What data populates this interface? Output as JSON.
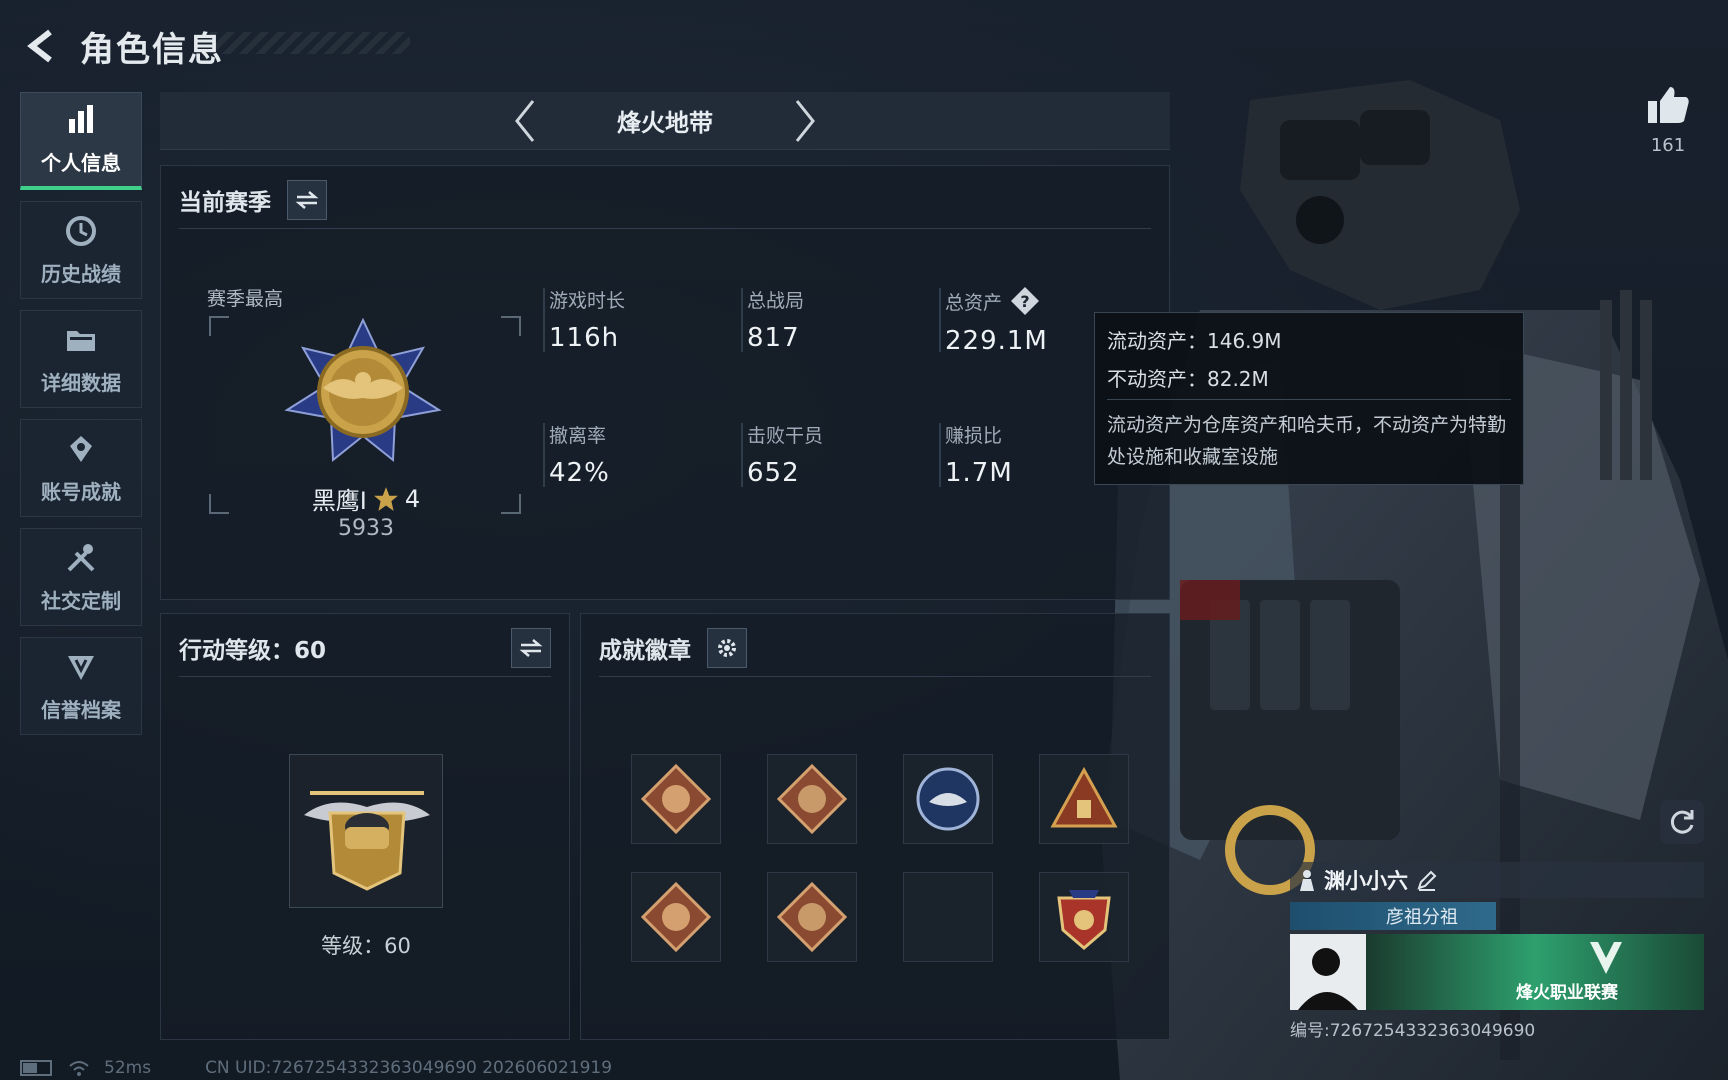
{
  "header": {
    "title": "角色信息"
  },
  "sidebar": {
    "items": [
      {
        "label": "个人信息",
        "icon": "bar-chart-icon",
        "active": true
      },
      {
        "label": "历史战绩",
        "icon": "clock-icon",
        "active": false
      },
      {
        "label": "详细数据",
        "icon": "folder-icon",
        "active": false
      },
      {
        "label": "账号成就",
        "icon": "achievement-icon",
        "active": false
      },
      {
        "label": "社交定制",
        "icon": "tools-icon",
        "active": false
      },
      {
        "label": "信誉档案",
        "icon": "shield-icon",
        "active": false
      }
    ]
  },
  "mode": {
    "title": "烽火地带"
  },
  "season": {
    "heading": "当前赛季",
    "best_label": "赛季最高",
    "rank_name": "黑鹰I",
    "rank_stars": "4",
    "rank_score": "5933",
    "stats": [
      {
        "key": "游戏时长",
        "value": "116h"
      },
      {
        "key": "总战局",
        "value": "817"
      },
      {
        "key": "总资产",
        "value": "229.1M"
      },
      {
        "key": "撤离率",
        "value": "42%"
      },
      {
        "key": "击败干员",
        "value": "652"
      },
      {
        "key": "赚损比",
        "value": "1.7M"
      }
    ]
  },
  "tooltip": {
    "liquid": "流动资产：146.9M",
    "fixed": "不动资产：82.2M",
    "desc": "流动资产为仓库资产和哈夫币，不动资产为特勤处设施和收藏室设施"
  },
  "level": {
    "heading": "行动等级：60",
    "level_text": "等级：60"
  },
  "medals": {
    "heading": "成就徽章"
  },
  "likes": {
    "count": "161"
  },
  "player": {
    "name": "渊小小六",
    "tag": "彦祖分祖",
    "league": "烽火职业联赛",
    "id_text": "编号:7267254332363049690"
  },
  "footer": {
    "latency": "52ms",
    "uid": "CN UID:7267254332363049690  202606021919"
  },
  "colors": {
    "accent": "#3fd18c",
    "panel_bg": "#141c27",
    "gold": "#c9a24a"
  }
}
